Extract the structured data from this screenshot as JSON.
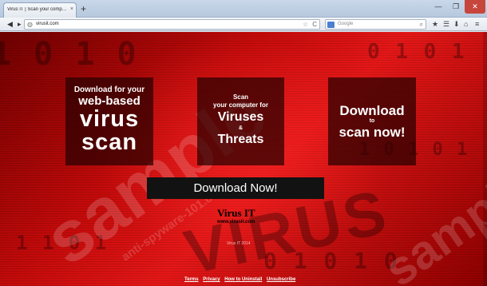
{
  "browser": {
    "tab_title": "Virus IT | Scan your computer f...",
    "tab_close": "×",
    "new_tab": "+",
    "window_min": "—",
    "window_max": "❐",
    "window_close": "✕",
    "back": "◀",
    "forward": "▸",
    "url": "virusit.com",
    "search_placeholder": "Google",
    "url_star": "☆",
    "reload": "C",
    "search_icon": "🔍",
    "tools": {
      "star": "★",
      "library": "☰",
      "download": "⬇",
      "home": "⌂",
      "menu": "≡"
    }
  },
  "page": {
    "box1": {
      "line1": "Download for your",
      "line2": "web-based",
      "line3": "virus",
      "line4": "scan"
    },
    "box2": {
      "line1": "Scan",
      "line2": "your computer for",
      "line3": "Viruses",
      "line4": "&",
      "line5": "Threats"
    },
    "box3": {
      "line1": "Download",
      "line2": "to",
      "line3": "scan now!"
    },
    "download_button": "Download Now!",
    "brand_name": "Virus IT",
    "brand_url": "www.virusit.com",
    "copyright": "Virus IT 2014",
    "footer_links": [
      "Terms",
      "Privacy",
      "How to Uninstall",
      "Unsubscribe"
    ],
    "background_word": "VIRUS",
    "watermark": "sample",
    "watermark_sub": "anti-spyware-101.com"
  }
}
